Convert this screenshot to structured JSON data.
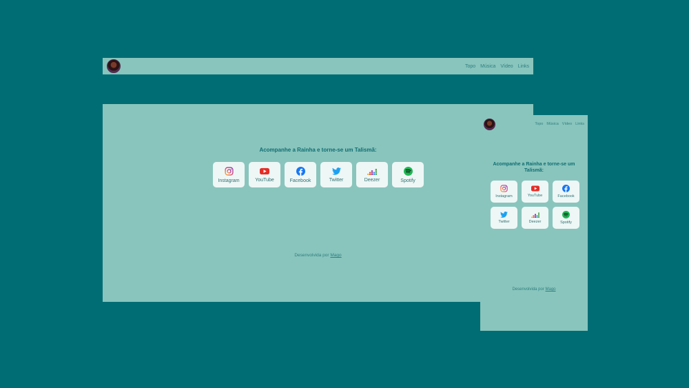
{
  "nav": {
    "links": [
      "Topo",
      "Música",
      "Vídeo",
      "Links"
    ]
  },
  "main": {
    "headline": "Acompanhe a Rainha e torne-se um Talismã:",
    "cards": [
      {
        "label": "Instagram",
        "icon": "instagram-icon"
      },
      {
        "label": "YouTube",
        "icon": "youtube-icon"
      },
      {
        "label": "Facebook",
        "icon": "facebook-icon"
      },
      {
        "label": "Twitter",
        "icon": "twitter-icon"
      },
      {
        "label": "Deezer",
        "icon": "deezer-icon"
      },
      {
        "label": "Spotify",
        "icon": "spotify-icon"
      }
    ],
    "footer_prefix": "Desenvolvida por",
    "footer_link": "Mago"
  },
  "colors": {
    "background": "#006d74",
    "page": "#89c5bd",
    "card": "#eef7f6",
    "text": "#2f7f80",
    "headline": "#0f6d72"
  }
}
